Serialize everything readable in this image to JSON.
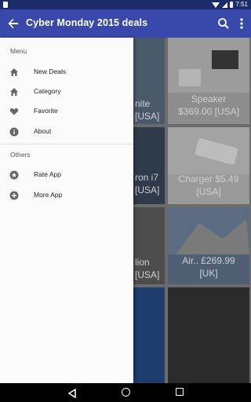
{
  "status_bar": {
    "time": "7:51"
  },
  "app_bar": {
    "title": "Cyber Monday 2015 deals"
  },
  "drawer": {
    "menu_header": "Menu",
    "menu_items": [
      {
        "label": "New Deals",
        "icon": "home-icon"
      },
      {
        "label": "Category",
        "icon": "home-icon"
      },
      {
        "label": "Favorite",
        "icon": "heart-icon"
      },
      {
        "label": "About",
        "icon": "info-icon"
      }
    ],
    "others_header": "Others",
    "other_items": [
      {
        "label": "Rate App",
        "icon": "star-circle-icon"
      },
      {
        "label": "More App",
        "icon": "add-circle-icon"
      }
    ]
  },
  "grid": {
    "cards": [
      {
        "caption": "nite\n[USA]"
      },
      {
        "caption": "Speaker\n$369.00 [USA]"
      },
      {
        "caption": "ron i7\n[USA]"
      },
      {
        "caption": "Charger $5.49\n[USA]"
      },
      {
        "caption": "lion\n[USA]"
      },
      {
        "caption": "Air.. £269.99\n[UK]"
      }
    ]
  },
  "colors": {
    "primary": "#3949ab",
    "status_bar": "#1c2b6a",
    "drawer_bg": "#fafafa",
    "icon_gray": "#666666"
  }
}
